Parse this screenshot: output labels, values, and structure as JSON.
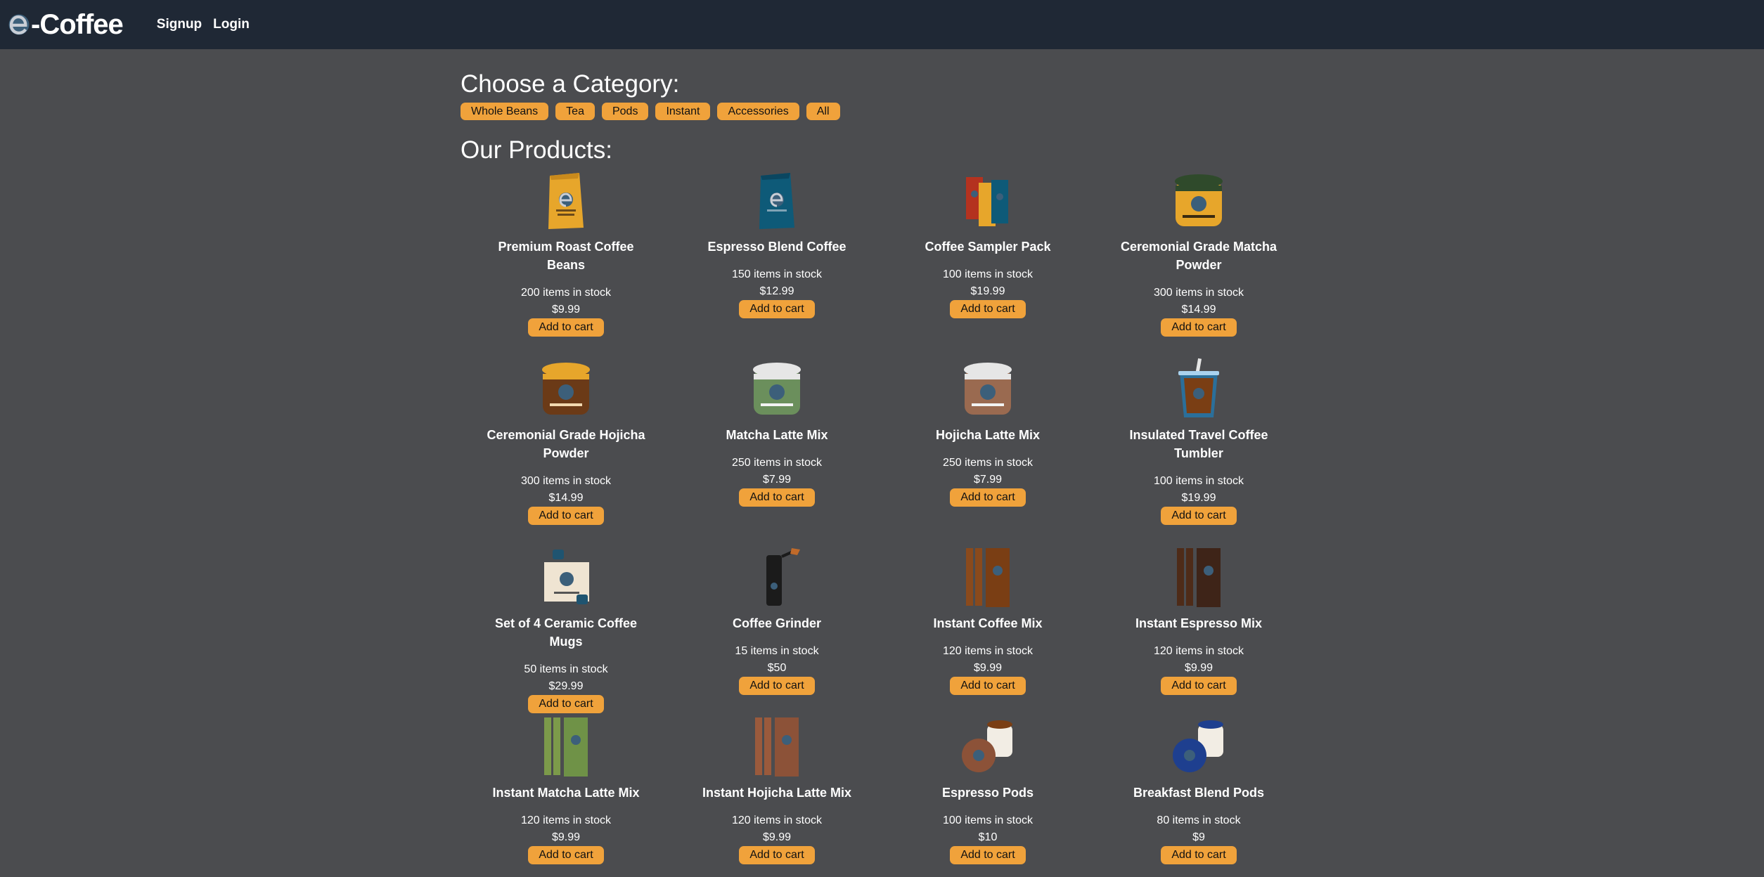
{
  "brand": {
    "name": "-Coffee",
    "logo_icon": "coffee-e-logo-icon"
  },
  "nav": {
    "signup": "Signup",
    "login": "Login"
  },
  "categories": {
    "heading": "Choose a Category:",
    "items": [
      "Whole Beans",
      "Tea",
      "Pods",
      "Instant",
      "Accessories",
      "All"
    ]
  },
  "products": {
    "heading": "Our Products:",
    "add_label": "Add to cart",
    "items": [
      {
        "name": "Premium Roast Coffee Beans",
        "stock": "200 items in stock",
        "price": "$9.99",
        "icon": "coffee-bag-icon"
      },
      {
        "name": "Espresso Blend Coffee",
        "stock": "150 items in stock",
        "price": "$12.99",
        "icon": "coffee-bag-icon"
      },
      {
        "name": "Coffee Sampler Pack",
        "stock": "100 items in stock",
        "price": "$19.99",
        "icon": "coffee-bags-icon"
      },
      {
        "name": "Ceremonial Grade Matcha Powder",
        "stock": "300 items in stock",
        "price": "$14.99",
        "icon": "powder-jar-icon"
      },
      {
        "name": "Ceremonial Grade Hojicha Powder",
        "stock": "300 items in stock",
        "price": "$14.99",
        "icon": "powder-jar-icon"
      },
      {
        "name": "Matcha Latte Mix",
        "stock": "250 items in stock",
        "price": "$7.99",
        "icon": "powder-jar-icon"
      },
      {
        "name": "Hojicha Latte Mix",
        "stock": "250 items in stock",
        "price": "$7.99",
        "icon": "powder-jar-icon"
      },
      {
        "name": "Insulated Travel Coffee Tumbler",
        "stock": "100 items in stock",
        "price": "$19.99",
        "icon": "tumbler-icon"
      },
      {
        "name": "Set of 4 Ceramic Coffee Mugs",
        "stock": "50 items in stock",
        "price": "$29.99",
        "icon": "mug-box-icon"
      },
      {
        "name": "Coffee Grinder",
        "stock": "15 items in stock",
        "price": "$50",
        "icon": "grinder-icon"
      },
      {
        "name": "Instant Coffee Mix",
        "stock": "120 items in stock",
        "price": "$9.99",
        "icon": "instant-sticks-icon"
      },
      {
        "name": "Instant Espresso Mix",
        "stock": "120 items in stock",
        "price": "$9.99",
        "icon": "instant-sticks-icon"
      },
      {
        "name": "Instant Matcha Latte Mix",
        "stock": "120 items in stock",
        "price": "$9.99",
        "icon": "instant-sticks-icon"
      },
      {
        "name": "Instant Hojicha Latte Mix",
        "stock": "120 items in stock",
        "price": "$9.99",
        "icon": "instant-sticks-icon"
      },
      {
        "name": "Espresso Pods",
        "stock": "100 items in stock",
        "price": "$10",
        "icon": "coffee-pods-icon"
      },
      {
        "name": "Breakfast Blend Pods",
        "stock": "80 items in stock",
        "price": "$9",
        "icon": "coffee-pods-icon"
      }
    ]
  },
  "colors": {
    "navbar": "#1f2835",
    "background": "#4b4c4f",
    "accent": "#f0a23b"
  }
}
